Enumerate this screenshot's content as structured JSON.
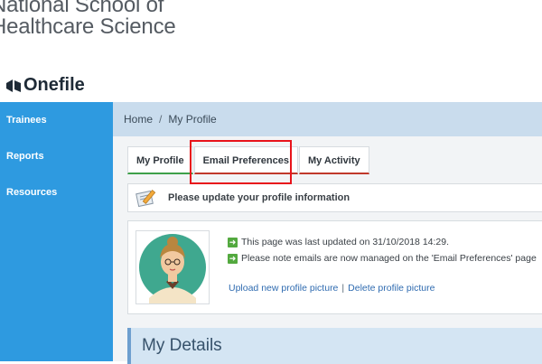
{
  "org": {
    "line1": "National School of",
    "line2": "Healthcare Science"
  },
  "app": {
    "logo_text": "Onefile"
  },
  "sidebar": {
    "items": [
      {
        "label": "Trainees"
      },
      {
        "label": "Reports"
      },
      {
        "label": "Resources"
      }
    ]
  },
  "breadcrumb": {
    "home": "Home",
    "separator": "/",
    "current": "My Profile"
  },
  "tabs": [
    {
      "label": "My Profile",
      "active": true
    },
    {
      "label": "Email Preferences",
      "active": false
    },
    {
      "label": "My Activity",
      "active": false
    }
  ],
  "notice": {
    "text": "Please update your profile information",
    "icon": "edit-note-icon"
  },
  "profile": {
    "last_updated": "This page was last updated on 31/10/2018 14:29.",
    "email_note": "Please note emails are now managed on the 'Email Preferences' page",
    "upload_link": "Upload new profile picture",
    "link_separator": "|",
    "delete_link": "Delete profile picture",
    "avatar_icon": "avatar-icon"
  },
  "details": {
    "title": "My Details"
  },
  "colors": {
    "sidebar": "#2e9ae0",
    "breadcrumb_bg": "#c9dced",
    "active_tab_underline": "#3ea04a",
    "inactive_tab_underline": "#c0392b",
    "highlight": "#e8141b",
    "link": "#2f6bb0",
    "arrow_green": "#53a93f"
  }
}
